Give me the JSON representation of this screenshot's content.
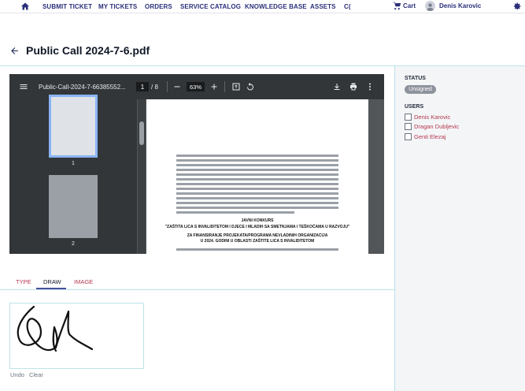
{
  "nav": {
    "items": [
      "SUBMIT TICKET",
      "MY TICKETS",
      "ORDERS",
      "SERVICE CATALOG",
      "KNOWLEDGE BASE",
      "ASSETS",
      "C("
    ],
    "cart_label": "Cart",
    "user_name": "Denis Karovic"
  },
  "page": {
    "title": "Public Call 2024-7-6.pdf"
  },
  "viewer": {
    "filename": "Public-Call-2024-7-66385552...",
    "current_page": "1",
    "total_pages": "/ 8",
    "zoom": "63%",
    "thumb_labels": [
      "1",
      "2"
    ],
    "doc": {
      "heading1": "JAVNI KONKURS",
      "heading2": "\"ZAŠTITA LICA S INVALIDITETOM I DJECE I MLADIH SA SMETNJAMA I TEŠKOĆAMA U RAZVOJU\"",
      "heading3": "ZA FINANSIRANJE PROJEKATA/PROGRAMA NEVLADINIH ORGANIZACIJA",
      "heading4": "U 2024. GODINI U OBLASTI ZAŠTITE LICA S INVALIDITETOM"
    }
  },
  "sidebar": {
    "status_label": "STATUS",
    "status_value": "Unsigned",
    "users_label": "USERS",
    "users": [
      "Denis Karovic",
      "Dragan Dubljevic",
      "Genti Elezaj"
    ]
  },
  "signature": {
    "tabs": [
      "TYPE",
      "DRAW",
      "IMAGE"
    ],
    "active_tab": "DRAW",
    "undo_label": "Undo",
    "clear_label": "Clear"
  },
  "colors": {
    "nav_text": "#2b2f7a",
    "accent_link": "#b5384f",
    "badge": "#8d929b",
    "viewer_bg": "#525659",
    "toolbar_bg": "#323639"
  }
}
